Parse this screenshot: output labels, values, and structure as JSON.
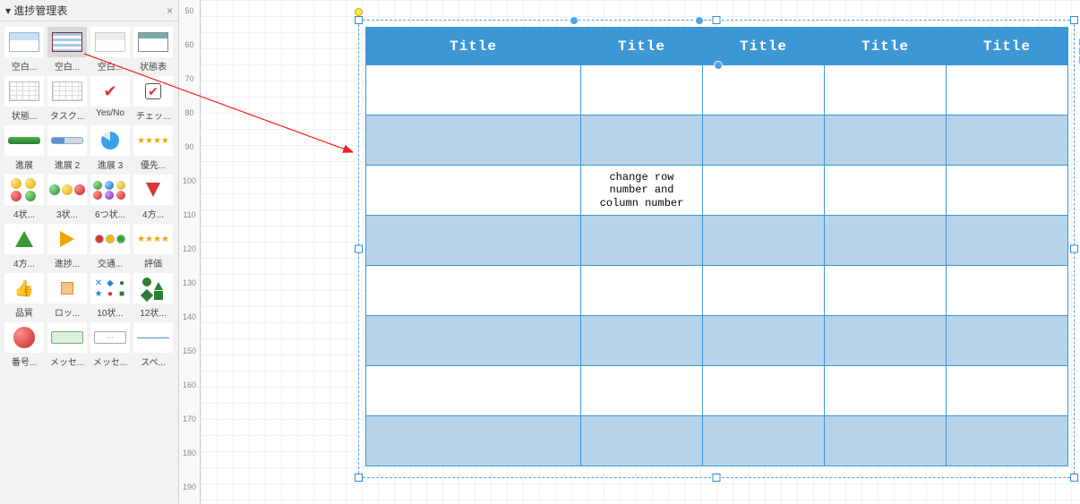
{
  "palette": {
    "title": "進捗管理表",
    "items": [
      {
        "label": "空白..."
      },
      {
        "label": "空白..."
      },
      {
        "label": "空白..."
      },
      {
        "label": "状態表"
      },
      {
        "label": "状態..."
      },
      {
        "label": "タスク..."
      },
      {
        "label": "Yes/No"
      },
      {
        "label": "チェッ..."
      },
      {
        "label": "進展"
      },
      {
        "label": "進展 2"
      },
      {
        "label": "進展 3"
      },
      {
        "label": "優先..."
      },
      {
        "label": "4状..."
      },
      {
        "label": "3状..."
      },
      {
        "label": "6つ状..."
      },
      {
        "label": "4方..."
      },
      {
        "label": "4方..."
      },
      {
        "label": "進捗..."
      },
      {
        "label": "交通..."
      },
      {
        "label": "評価"
      },
      {
        "label": "品質"
      },
      {
        "label": "ロッ..."
      },
      {
        "label": "10状..."
      },
      {
        "label": "12状..."
      },
      {
        "label": "番号..."
      },
      {
        "label": "メッセ..."
      },
      {
        "label": "メッセ..."
      },
      {
        "label": "スペ..."
      }
    ]
  },
  "ruler": {
    "ticks": [
      50,
      60,
      70,
      80,
      90,
      100,
      110,
      120,
      130,
      140,
      150,
      160,
      170,
      180,
      190
    ]
  },
  "table": {
    "headers": [
      "Title",
      "Title",
      "Title",
      "Title",
      "Title"
    ],
    "cell_note": "change row\nnumber and\ncolumn number"
  }
}
